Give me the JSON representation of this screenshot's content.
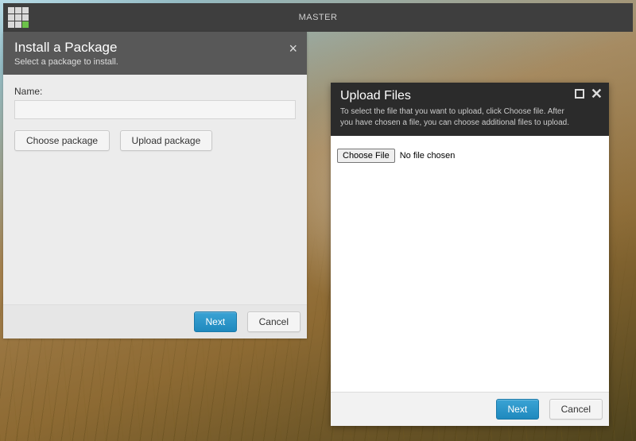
{
  "topbar": {
    "title": "MASTER"
  },
  "install": {
    "title": "Install a Package",
    "subtitle": "Select a package to install.",
    "name_label": "Name:",
    "name_value": "",
    "choose_label": "Choose package",
    "upload_label": "Upload package",
    "next_label": "Next",
    "cancel_label": "Cancel"
  },
  "upload": {
    "title": "Upload Files",
    "subtitle": "To select the file that you want to upload, click Choose file. After you have chosen a file, you can choose additional files to upload.",
    "choose_file_label": "Choose File",
    "file_status": "No file chosen",
    "next_label": "Next",
    "cancel_label": "Cancel"
  }
}
